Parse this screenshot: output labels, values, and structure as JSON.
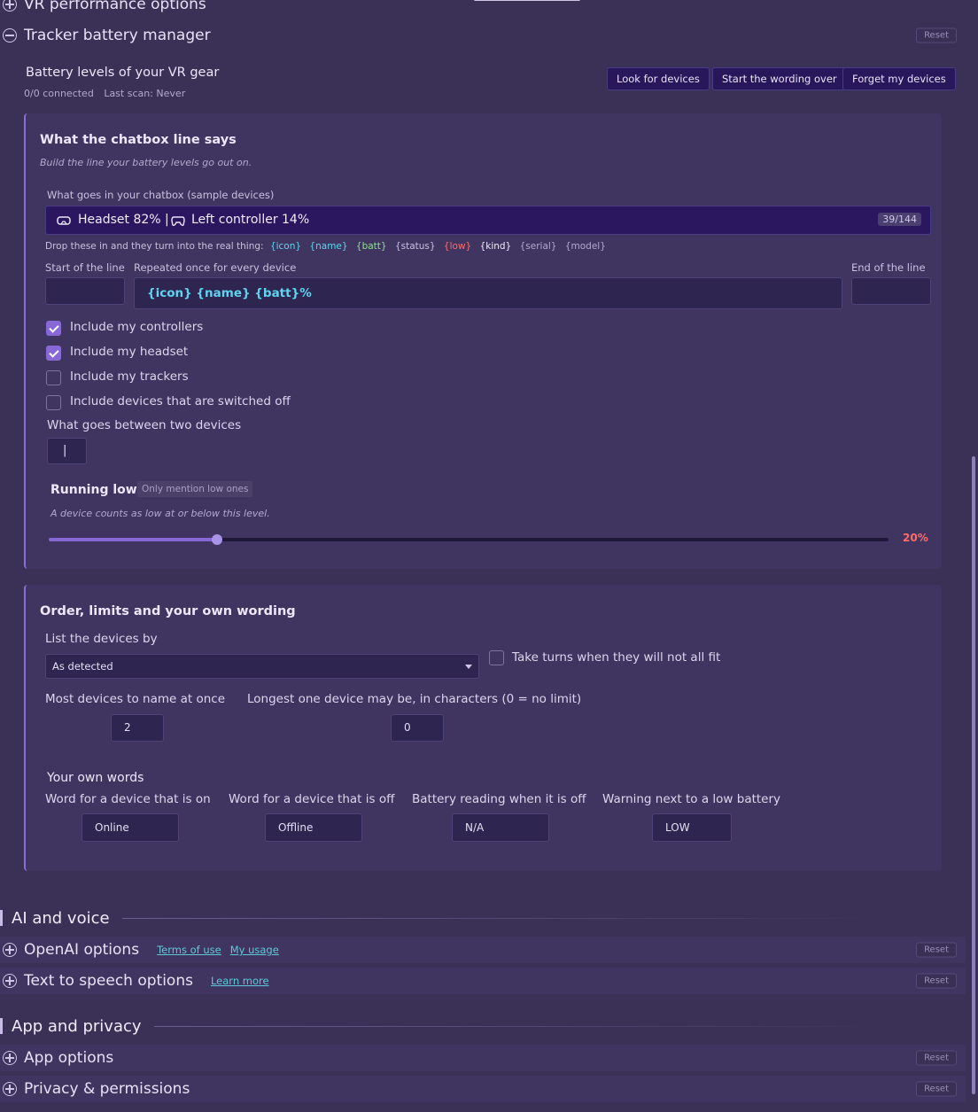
{
  "sections": {
    "vr_performance": "VR performance options",
    "tracker_battery": "Tracker battery manager",
    "reset_label": "Reset"
  },
  "battery": {
    "heading": "Battery levels of your VR gear",
    "connected": "0/0 connected",
    "last_scan": "Last scan: Never",
    "btn_look": "Look for devices",
    "btn_start_over": "Start the wording over",
    "btn_forget": "Forget my devices"
  },
  "chatbox": {
    "title": "What the chatbox line says",
    "subtitle": "Build the line your battery levels go out on.",
    "preview_label": "What goes in your chatbox (sample devices)",
    "preview_headset": "Headset 82% |",
    "preview_controller": "Left controller 14%",
    "preview_count": "39/144",
    "tokens_intro": "Drop these in and they turn into the real thing:",
    "tokens": [
      "{icon}",
      "{name}",
      "{batt}",
      "{status}",
      "{low}",
      "{kind}",
      "{serial}",
      "{model}"
    ],
    "tokens_colors": [
      "#5fd3ef",
      "#5fd3ef",
      "#8fe08f",
      "#c9c1de",
      "#ff6b6b",
      "#f0ecfa",
      "#b3a9cf",
      "#b3a9cf"
    ],
    "start_label": "Start of the line",
    "repeat_label": "Repeated once for every device",
    "end_label": "End of the line",
    "repeat_value": "{icon} {name} {batt}%",
    "include_controllers": "Include my controllers",
    "include_headset": "Include my headset",
    "include_trackers": "Include my trackers",
    "include_off": "Include devices that are switched off",
    "between_label": "What goes between two devices",
    "between_value": "|",
    "low_title": "Running low",
    "low_badge": "Only mention low ones",
    "low_hint": "A device counts as low at or below this level.",
    "low_value_label": "20%",
    "low_value": 20
  },
  "order": {
    "title": "Order, limits and your own wording",
    "list_by_label": "List the devices by",
    "list_by_value": "As detected",
    "take_turns": "Take turns when they will not all fit",
    "most_devices_label": "Most devices to name at once",
    "most_devices_value": "2",
    "longest_label": "Longest one device may be, in characters (0 = no limit)",
    "longest_value": "0",
    "own_words_title": "Your own words",
    "word_on_label": "Word for a device that is on",
    "word_on_value": "Online",
    "word_off_label": "Word for a device that is off",
    "word_off_value": "Offline",
    "reading_off_label": "Battery reading when it is off",
    "reading_off_value": "N/A",
    "warning_label": "Warning next to a low battery",
    "warning_value": "LOW"
  },
  "ai_group": {
    "title": "AI and voice",
    "openai": "OpenAI options",
    "openai_terms": "Terms of use",
    "openai_usage": "My usage",
    "tts": "Text to speech options",
    "tts_learn": "Learn more"
  },
  "app_group": {
    "title": "App and privacy",
    "app_options": "App options",
    "privacy": "Privacy & permissions"
  }
}
